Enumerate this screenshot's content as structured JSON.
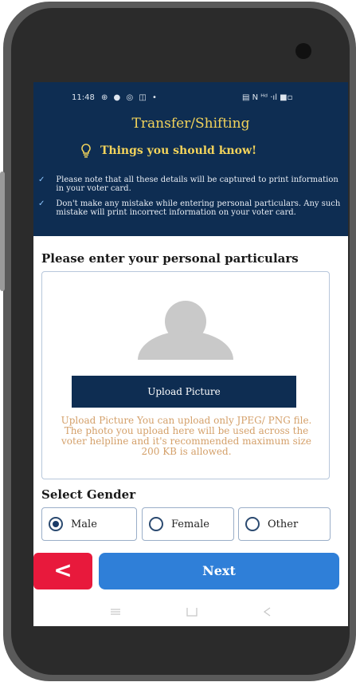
{
  "status_bar": {
    "time": "11:48",
    "left_icons": "⊕ ● ◎ ◫ •",
    "right_icons": "▤ N ᴴᵈ ‧ıl ■▫"
  },
  "header": {
    "title": "Transfer/Shifting",
    "banner_text": "Things you should know!",
    "notes": [
      "Please note that all these details will be captured to print information in your voter card.",
      "Don't make any mistake while entering personal particulars. Any such mistake will print incorrect information on your voter card."
    ]
  },
  "form": {
    "section_title": "Please enter your personal particulars",
    "upload_button": "Upload Picture",
    "upload_help": "Upload Picture You can upload only JPEG/ PNG file. The photo you upload here will be used across the voter helpline and it's recommended maximum size 200 KB is allowed.",
    "gender_title": "Select Gender",
    "gender_options": [
      {
        "label": "Male",
        "selected": true
      },
      {
        "label": "Female",
        "selected": false
      },
      {
        "label": "Other",
        "selected": false
      }
    ]
  },
  "actions": {
    "back_label": "<",
    "next_label": "Next"
  },
  "colors": {
    "header_bg": "#0e2d52",
    "accent_yellow": "#f2d35b",
    "next_blue": "#2f7fd8",
    "back_red": "#e8193c",
    "help_text": "#d4a06a"
  },
  "icons": {
    "bulb": "lightbulb-icon",
    "avatar": "avatar-placeholder-icon",
    "nav_recent": "recent-apps-icon",
    "nav_home": "home-icon",
    "nav_back": "back-icon"
  }
}
